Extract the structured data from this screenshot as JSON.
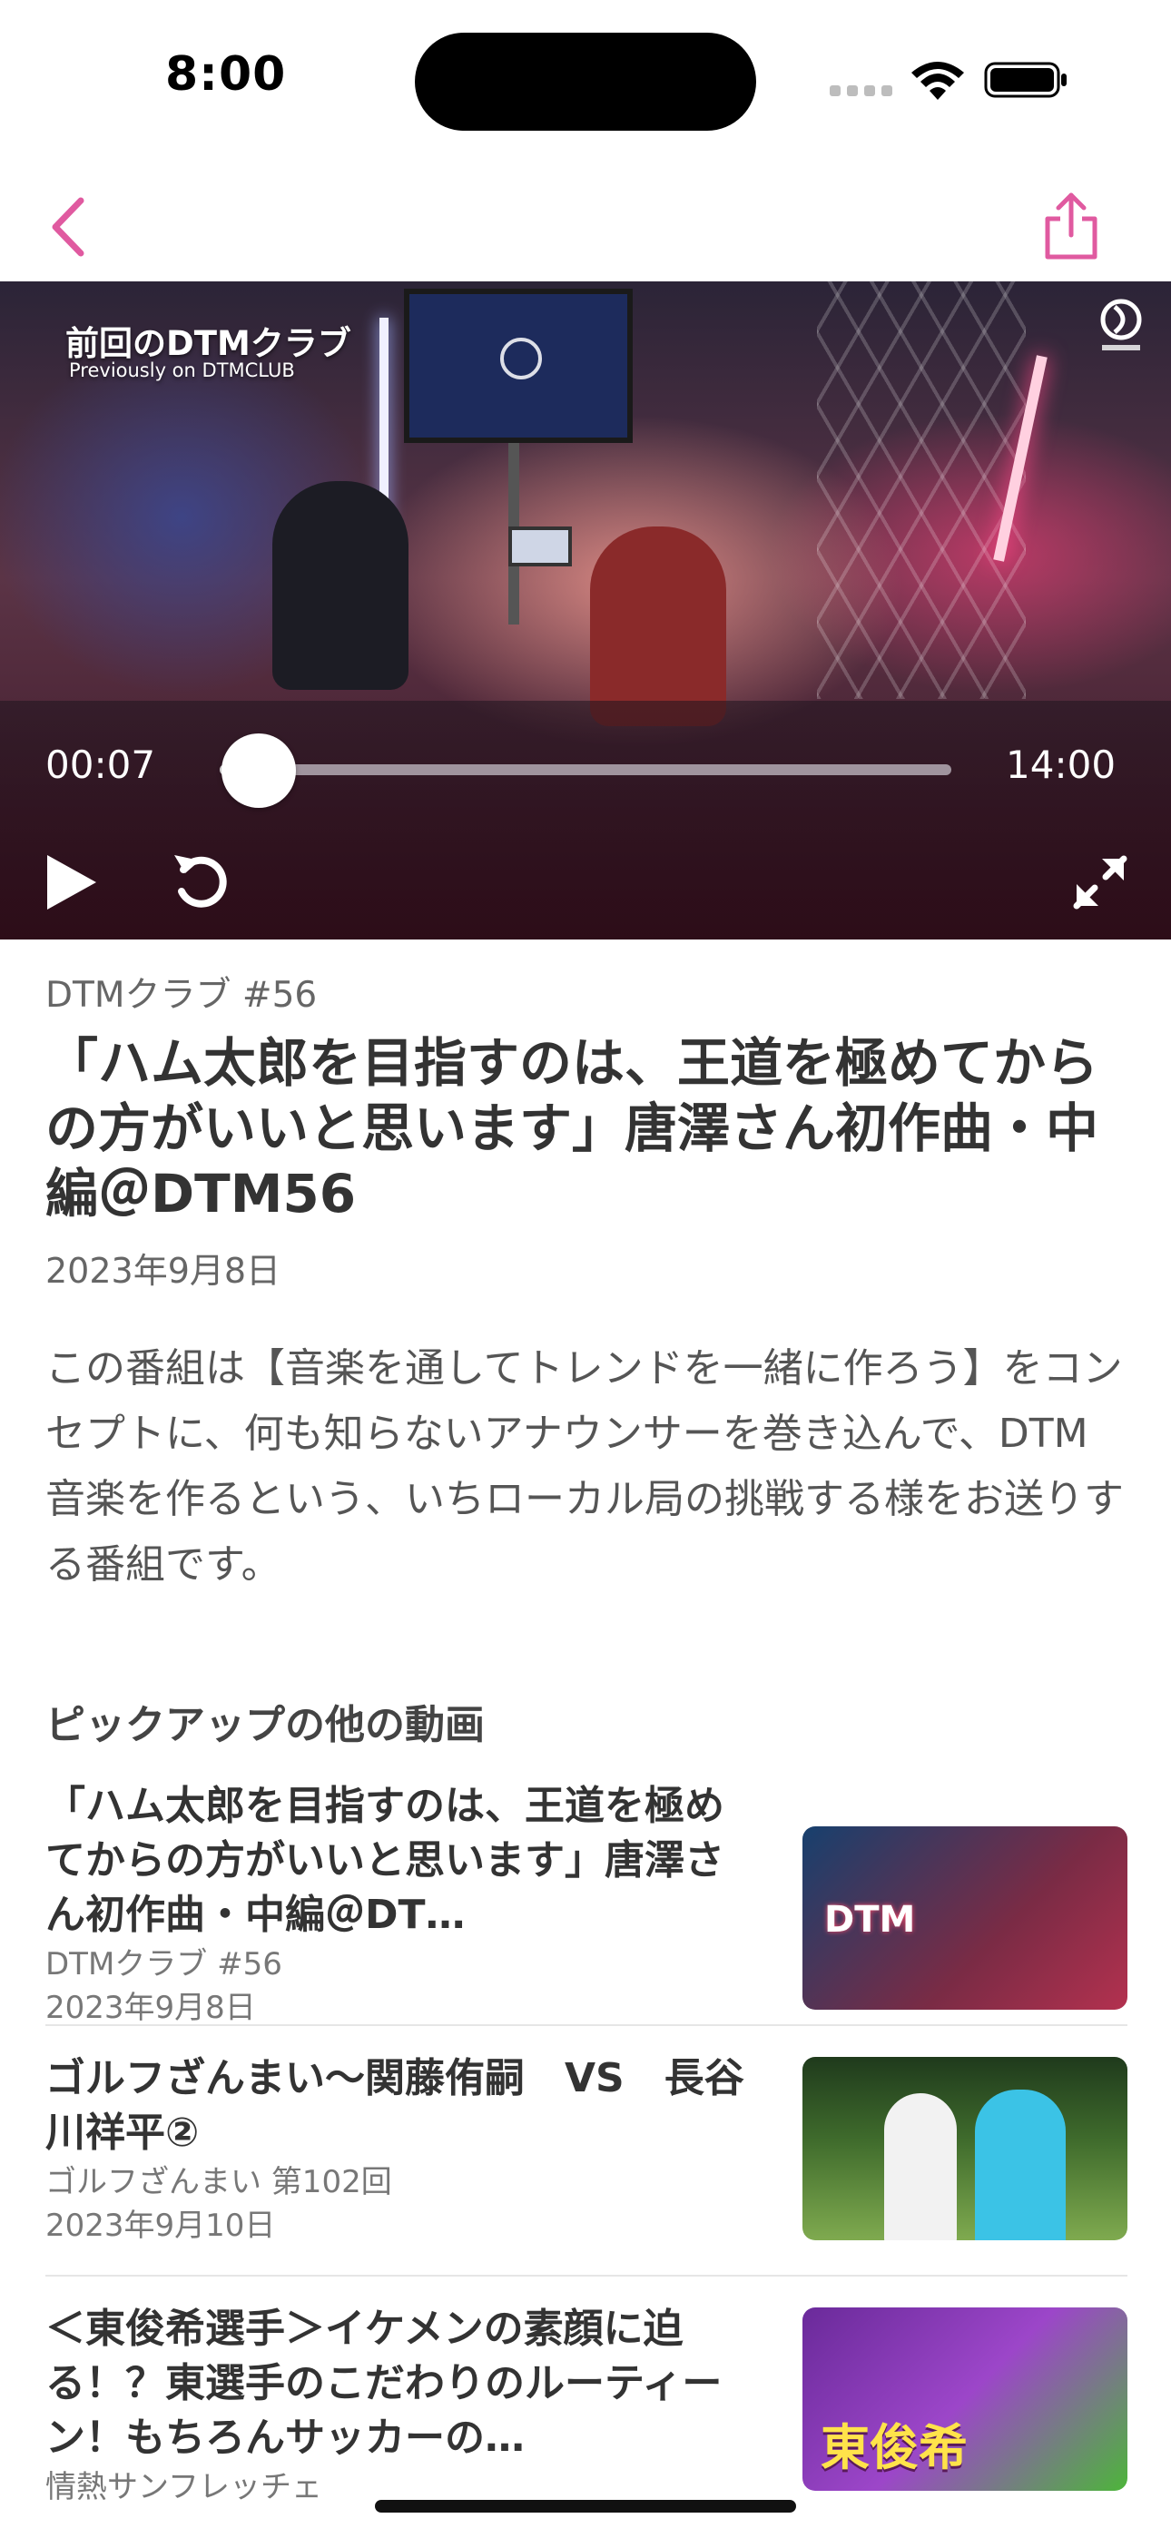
{
  "status_bar": {
    "time": "8:00"
  },
  "colors": {
    "accent": "#e05aa0",
    "text_primary": "#333333",
    "text_secondary": "#666666"
  },
  "video": {
    "overlay_title": "前回のDTMクラブ",
    "overlay_subtitle": "Previously on DTMCLUB",
    "current_time": "00:07",
    "total_time": "14:00",
    "progress_fraction": 0.008
  },
  "program": {
    "series": "DTMクラブ #56",
    "title": "「ハム太郎を目指すのは、王道を極めてからの方がいいと思います」唐澤さん初作曲・中編＠DTM56",
    "date": "2023年9月8日",
    "description": "この番組は【音楽を通してトレンドを一緒に作ろう】をコンセプトに、何も知らないアナウンサーを巻き込んで、DTM音楽を作るという、いちローカル局の挑戦する様をお送りする番組です。"
  },
  "pickup": {
    "section_title": "ピックアップの他の動画",
    "items": [
      {
        "title": "「ハム太郎を目指すのは、王道を極めてからの方がいいと思います」唐澤さん初作曲・中編＠DT…",
        "series": "DTMクラブ #56",
        "date": "2023年9月8日"
      },
      {
        "title": "ゴルフざんまい〜関藤侑嗣　VS　長谷川祥平②",
        "series": "ゴルフざんまい 第102回",
        "date": "2023年9月10日"
      },
      {
        "title": "＜東俊希選手＞イケメンの素顔に迫る！？東選手のこだわりのルーティーン！もちろんサッカーの…",
        "series": "情熱サンフレッチェ",
        "date": ""
      }
    ]
  },
  "icons": {
    "back": "chevron-left-icon",
    "share": "share-icon",
    "play": "play-icon",
    "replay": "replay-icon",
    "fullscreen": "fullscreen-icon"
  }
}
